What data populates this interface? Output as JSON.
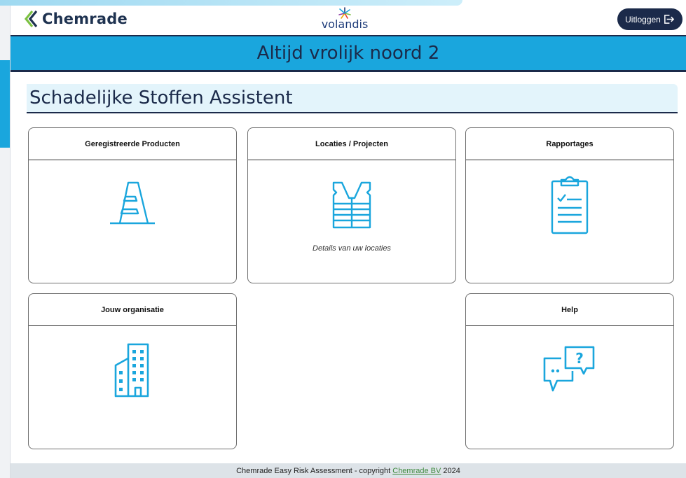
{
  "brand": {
    "logo_text": "Chemrade",
    "partner_text": "volandis"
  },
  "header": {
    "logout_label": "Uitloggen"
  },
  "banner": {
    "title": "Altijd vrolijk noord 2"
  },
  "page": {
    "title": "Schadelijke Stoffen Assistent"
  },
  "cards": [
    {
      "title": "Geregistreerde Producten",
      "icon": "traffic-cone-icon",
      "description": ""
    },
    {
      "title": "Locaties / Projecten",
      "icon": "safety-vest-icon",
      "description": "Details van uw locaties"
    },
    {
      "title": "Rapportages",
      "icon": "clipboard-checklist-icon",
      "description": ""
    },
    {
      "title": "Jouw organisatie",
      "icon": "buildings-icon",
      "description": ""
    },
    {
      "title": "Help",
      "icon": "chat-question-icon",
      "description": ""
    }
  ],
  "footer": {
    "text_before": "Chemrade Easy Risk Assessment - copyright ",
    "link_text": "Chemrade BV",
    "text_after": " 2024"
  },
  "colors": {
    "accent": "#1aa6dd",
    "dark": "#1b2a4a",
    "subheader_bg": "#e3f4fb",
    "logo_green": "#7cc142"
  }
}
